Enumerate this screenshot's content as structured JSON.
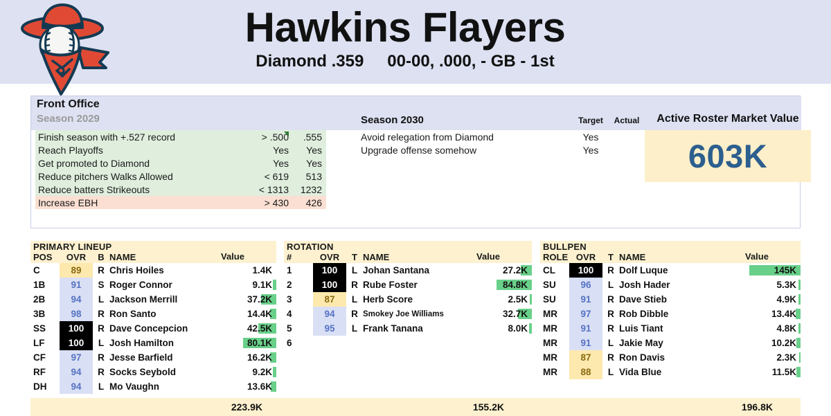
{
  "header": {
    "team_name": "Hawkins Flayers",
    "league": "Diamond .359",
    "record": "00-00, .000, - GB - 1st",
    "logo_icon": "baseball-bandit-mascot-icon",
    "bg_color": "#dde1f2"
  },
  "front_office": {
    "title": "Front Office",
    "season_label": "Season 2029",
    "goals": [
      {
        "name": "Finish season with +.527 record",
        "target": "> .500",
        "actual": ".555",
        "status": "ok",
        "marker": true
      },
      {
        "name": "Reach Playoffs",
        "target": "Yes",
        "actual": "Yes",
        "status": "ok",
        "marker": false
      },
      {
        "name": "Get promoted to Diamond",
        "target": "Yes",
        "actual": "Yes",
        "status": "ok",
        "marker": false
      },
      {
        "name": "Reduce pitchers Walks Allowed",
        "target": "< 619",
        "actual": "513",
        "status": "ok",
        "marker": false
      },
      {
        "name": "Reduce batters Strikeouts",
        "target": "< 1313",
        "actual": "1232",
        "status": "ok",
        "marker": false
      },
      {
        "name": "Increase EBH",
        "target": "> 430",
        "actual": "426",
        "status": "fail",
        "marker": false
      }
    ],
    "next_season": {
      "title": "Season 2030",
      "col_target": "Target",
      "col_actual": "Actual",
      "goals": [
        {
          "name": "Avoid relegation from Diamond",
          "target": "Yes",
          "actual": ""
        },
        {
          "name": "Upgrade offense somehow",
          "target": "Yes",
          "actual": ""
        }
      ]
    },
    "market_value": {
      "title": "Active Roster Market Value",
      "value": "603K",
      "value_color": "#2c5f8f",
      "bg_color": "#fdefc9"
    }
  },
  "roster": {
    "lineup": {
      "caption": "PRIMARY LINEUP",
      "columns": {
        "pos": "POS",
        "ovr": "OVR",
        "hand": "B",
        "name": "NAME",
        "value": "Value"
      },
      "total": "223.9K",
      "rows": [
        {
          "pos": "C",
          "ovr": "89",
          "tier": "low",
          "hand": "R",
          "name": "Chris Hoiles",
          "value": "1.4K",
          "bar": 0
        },
        {
          "pos": "1B",
          "ovr": "91",
          "tier": "mid",
          "hand": "S",
          "name": "Roger Connor",
          "value": "9.1K",
          "bar": 6
        },
        {
          "pos": "2B",
          "ovr": "94",
          "tier": "mid",
          "hand": "L",
          "name": "Jackson Merrill",
          "value": "37.2K",
          "bar": 26
        },
        {
          "pos": "3B",
          "ovr": "98",
          "tier": "mid",
          "hand": "R",
          "name": "Ron Santo",
          "value": "14.4K",
          "bar": 10
        },
        {
          "pos": "SS",
          "ovr": "100",
          "tier": "max",
          "hand": "R",
          "name": "Dave Concepcion",
          "value": "42.5K",
          "bar": 30
        },
        {
          "pos": "LF",
          "ovr": "100",
          "tier": "max",
          "hand": "L",
          "name": "Josh Hamilton",
          "value": "80.1K",
          "bar": 56
        },
        {
          "pos": "CF",
          "ovr": "97",
          "tier": "mid",
          "hand": "R",
          "name": "Jesse Barfield",
          "value": "16.2K",
          "bar": 11
        },
        {
          "pos": "RF",
          "ovr": "94",
          "tier": "mid",
          "hand": "R",
          "name": "Socks Seybold",
          "value": "9.2K",
          "bar": 6
        },
        {
          "pos": "DH",
          "ovr": "94",
          "tier": "mid",
          "hand": "L",
          "name": "Mo Vaughn",
          "value": "13.6K",
          "bar": 9
        }
      ]
    },
    "rotation": {
      "caption": "ROTATION",
      "columns": {
        "pos": "#",
        "ovr": "OVR",
        "hand": "T",
        "name": "NAME",
        "value": "Value"
      },
      "total": "155.2K",
      "rows": [
        {
          "pos": "1",
          "ovr": "100",
          "tier": "max",
          "hand": "L",
          "name": "Johan Santana",
          "value": "27.2K",
          "bar": 19,
          "small": false
        },
        {
          "pos": "2",
          "ovr": "100",
          "tier": "max",
          "hand": "R",
          "name": "Rube Foster",
          "value": "84.8K",
          "bar": 59,
          "small": false
        },
        {
          "pos": "3",
          "ovr": "87",
          "tier": "low",
          "hand": "L",
          "name": "Herb Score",
          "value": "2.5K",
          "bar": 3,
          "small": false
        },
        {
          "pos": "4",
          "ovr": "94",
          "tier": "mid",
          "hand": "R",
          "name": "Smokey Joe Williams",
          "value": "32.7K",
          "bar": 23,
          "small": true
        },
        {
          "pos": "5",
          "ovr": "95",
          "tier": "mid",
          "hand": "L",
          "name": "Frank Tanana",
          "value": "8.0K",
          "bar": 5,
          "small": false
        },
        {
          "pos": "6",
          "ovr": "",
          "tier": "none",
          "hand": "",
          "name": "",
          "value": "",
          "bar": 0,
          "small": false
        }
      ]
    },
    "bullpen": {
      "caption": "BULLPEN",
      "columns": {
        "pos": "ROLE",
        "ovr": "OVR",
        "hand": "T",
        "name": "NAME",
        "value": "Value"
      },
      "total": "196.8K",
      "rows": [
        {
          "pos": "CL",
          "ovr": "100",
          "tier": "max",
          "hand": "R",
          "name": "Dolf Luque",
          "value": "145K",
          "bar": 86
        },
        {
          "pos": "SU",
          "ovr": "96",
          "tier": "mid",
          "hand": "L",
          "name": "Josh Hader",
          "value": "5.3K",
          "bar": 4
        },
        {
          "pos": "SU",
          "ovr": "91",
          "tier": "mid",
          "hand": "R",
          "name": "Dave Stieb",
          "value": "4.9K",
          "bar": 3
        },
        {
          "pos": "MR",
          "ovr": "97",
          "tier": "mid",
          "hand": "R",
          "name": "Rob Dibble",
          "value": "13.4K",
          "bar": 8
        },
        {
          "pos": "MR",
          "ovr": "91",
          "tier": "mid",
          "hand": "R",
          "name": "Luis Tiant",
          "value": "4.8K",
          "bar": 3
        },
        {
          "pos": "MR",
          "ovr": "91",
          "tier": "mid",
          "hand": "L",
          "name": "Jakie May",
          "value": "10.2K",
          "bar": 7
        },
        {
          "pos": "MR",
          "ovr": "87",
          "tier": "low",
          "hand": "R",
          "name": "Ron Davis",
          "value": "2.3K",
          "bar": 2
        },
        {
          "pos": "MR",
          "ovr": "88",
          "tier": "low",
          "hand": "L",
          "name": "Vida Blue",
          "value": "11.5K",
          "bar": 7
        }
      ]
    }
  }
}
